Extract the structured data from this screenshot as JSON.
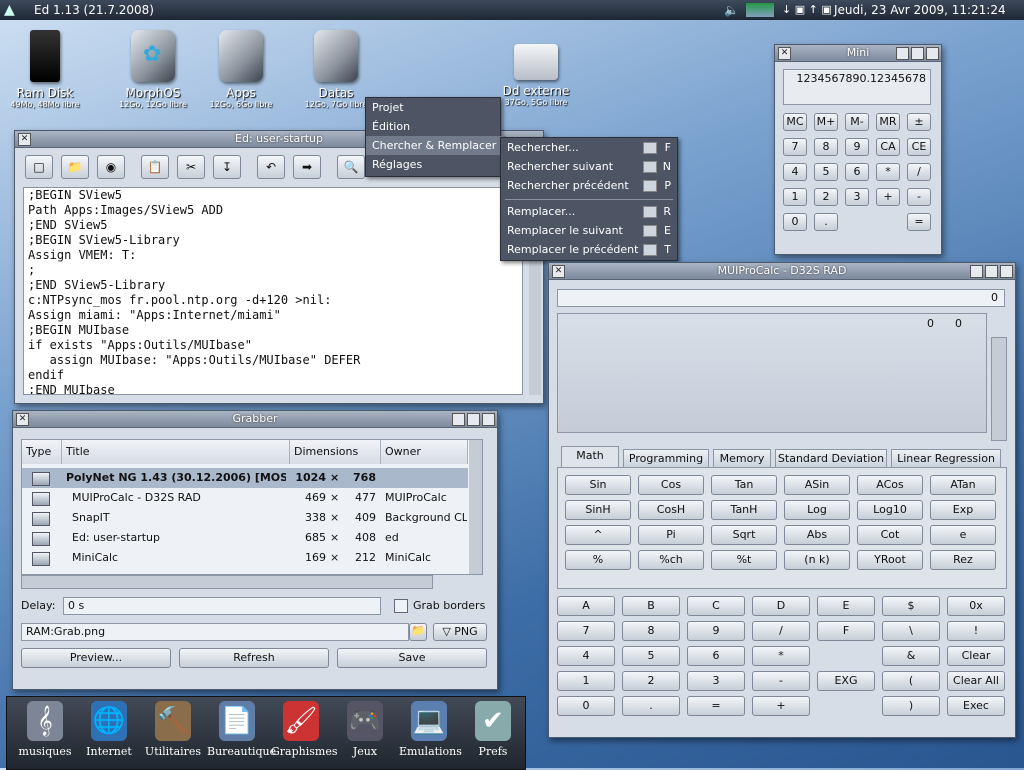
{
  "topbar": {
    "title": "Ed 1.13 (21.7.2008)",
    "status": "↓ ▣ ↑ ▣",
    "clock": "Jeudi, 23 Avr 2009, 11:21:24"
  },
  "desktop": [
    {
      "name": "Ram Disk",
      "sub": "49Mo, 48Mo libre"
    },
    {
      "name": "MorphOS",
      "sub": "12Go, 12Go libre"
    },
    {
      "name": "Apps",
      "sub": "12Go, 6Go libre"
    },
    {
      "name": "Datas",
      "sub": "12Go, 7Go libre"
    },
    {
      "name": "Dd externe",
      "sub": "37Go, 5Go libre"
    }
  ],
  "editor": {
    "title": "Ed: user-startup",
    "lines": [
      ";BEGIN SView5",
      "Path Apps:Images/SView5 ADD",
      ";END SView5",
      ";BEGIN SView5-Library",
      "Assign VMEM: T:",
      ";",
      ";END SView5-Library",
      "c:NTPsync_mos fr.pool.ntp.org -d+120 >nil:",
      "Assign miami: \"Apps:Internet/miami\"",
      ";BEGIN MUIbase",
      "if exists \"Apps:Outils/MUIbase\"",
      "   assign MUIbase: \"Apps:Outils/MUIbase\" DEFER",
      "endif",
      ";END MUIbase"
    ]
  },
  "menu": {
    "items": [
      "Projet",
      "Édition",
      "Chercher & Remplacer",
      "Réglages"
    ]
  },
  "submenu": [
    {
      "label": "Rechercher...",
      "key": "F"
    },
    {
      "label": "Rechercher suivant",
      "key": "N"
    },
    {
      "label": "Rechercher précédent",
      "key": "P"
    },
    {
      "label": "Remplacer...",
      "key": "R"
    },
    {
      "label": "Remplacer le suivant",
      "key": "E"
    },
    {
      "label": "Remplacer le précédent",
      "key": "T"
    }
  ],
  "mini": {
    "title": "Mini",
    "display": "1234567890.12345678",
    "rows": [
      [
        "MC",
        "M+",
        "M-",
        "MR",
        "±"
      ],
      [
        "7",
        "8",
        "9",
        "CA",
        "CE"
      ],
      [
        "4",
        "5",
        "6",
        "*",
        "/"
      ],
      [
        "1",
        "2",
        "3",
        "+",
        "-"
      ],
      [
        "0",
        ".",
        "",
        "",
        "="
      ]
    ]
  },
  "grabber": {
    "title": "Grabber",
    "headers": [
      "Type",
      "Title",
      "Dimensions",
      "Owner"
    ],
    "rows": [
      {
        "title": "PolyNet NG 1.43 (30.12.2006) [MOS]",
        "w": "1024",
        "h": "768",
        "owner": ""
      },
      {
        "title": "MUIProCalc - D32S RAD",
        "w": "469",
        "h": "477",
        "owner": "MUIProCalc"
      },
      {
        "title": "SnapIT",
        "w": "338",
        "h": "409",
        "owner": "Background CL"
      },
      {
        "title": "Ed: user-startup",
        "w": "685",
        "h": "408",
        "owner": "ed"
      },
      {
        "title": "MiniCalc",
        "w": "169",
        "h": "212",
        "owner": "MiniCalc"
      }
    ],
    "times": "×",
    "delay_label": "Delay:",
    "delay_value": "0 s",
    "grab_borders": "Grab borders",
    "file": "RAM:Grab.png",
    "format": "▽ PNG",
    "preview": "Preview...",
    "refresh": "Refresh",
    "save": "Save"
  },
  "muicalc": {
    "title": "MUIProCalc - D32S RAD",
    "display": "0",
    "reg1": "0",
    "reg2": "0",
    "tabs": [
      "Math",
      "Programming",
      "Memory",
      "Standard Deviation",
      "Linear Regression"
    ],
    "math": [
      [
        "Sin",
        "Cos",
        "Tan",
        "ASin",
        "ACos",
        "ATan"
      ],
      [
        "SinH",
        "CosH",
        "TanH",
        "Log",
        "Log10",
        "Exp"
      ],
      [
        "^",
        "Pi",
        "Sqrt",
        "Abs",
        "Cot",
        "e"
      ],
      [
        "%",
        "%ch",
        "%t",
        "(n k)",
        "YRoot",
        "Rez"
      ]
    ],
    "keys": [
      [
        "A",
        "B",
        "C",
        "D",
        "E",
        "$",
        "0x"
      ],
      [
        "7",
        "8",
        "9",
        "/",
        "F",
        "\\",
        "!"
      ],
      [
        "4",
        "5",
        "6",
        "*",
        "",
        "&",
        "Clear"
      ],
      [
        "1",
        "2",
        "3",
        "-",
        "EXG",
        "(",
        "Clear All"
      ],
      [
        "0",
        ".",
        "=",
        "+",
        "",
        ")",
        "Exec"
      ]
    ]
  },
  "dock": [
    "musiques",
    "Internet",
    "Utilitaires",
    "Bureautique",
    "Graphismes",
    "Jeux",
    "Emulations",
    "Prefs"
  ]
}
